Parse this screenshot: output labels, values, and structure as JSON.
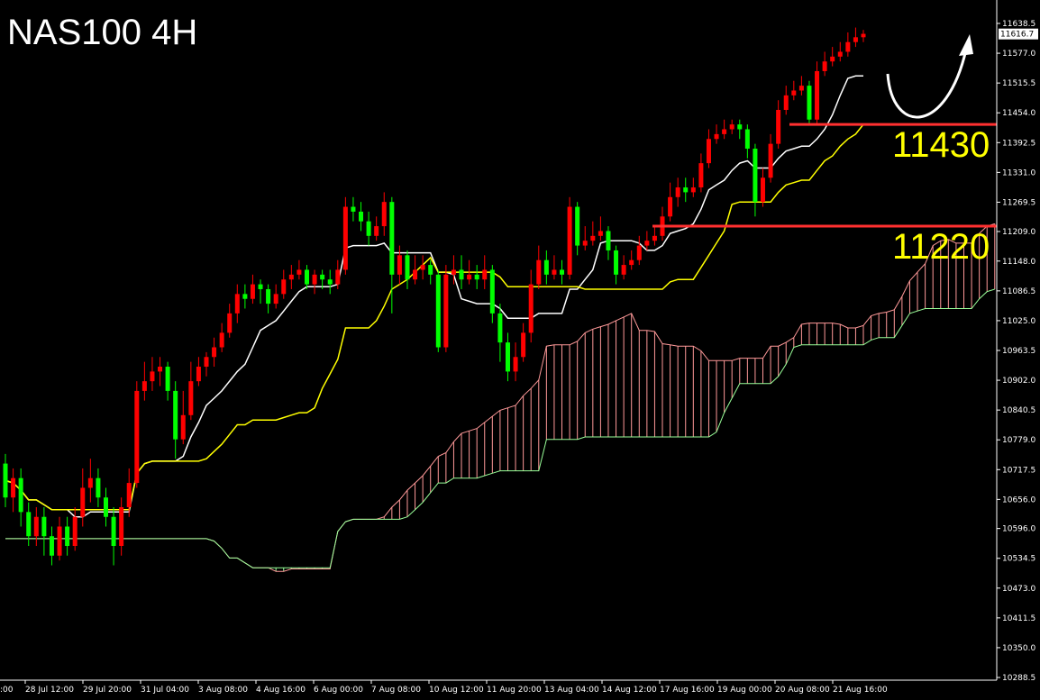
{
  "title": "NAS100 4H",
  "chart_data": {
    "type": "candlestick",
    "symbol": "NAS100",
    "timeframe": "4H",
    "ylim": [
      10288.5,
      11638.5
    ],
    "y_ticks": [
      "11638.5",
      "11577.0",
      "11515.5",
      "11454.0",
      "11392.5",
      "11331.0",
      "11269.5",
      "11209.0",
      "11148.0",
      "11086.5",
      "11025.0",
      "10963.5",
      "10902.0",
      "10840.5",
      "10779.0",
      "10717.5",
      "10656.0",
      "10596.0",
      "10534.5",
      "10473.0",
      "10411.5",
      "10350.0",
      "10288.5"
    ],
    "current_price": "11616.7",
    "x_ticks": [
      "28 Jul 12:00",
      "29 Jul 20:00",
      "31 Jul 04:00",
      "3 Aug 08:00",
      "4 Aug 16:00",
      "6 Aug 00:00",
      "7 Aug 08:00",
      "10 Aug 12:00",
      "11 Aug 20:00",
      "13 Aug 04:00",
      "14 Aug 12:00",
      "17 Aug 16:00",
      "19 Aug 00:00",
      "20 Aug 08:00",
      "21 Aug 16:00"
    ],
    "x_tick_first_partial": ":00",
    "up_color": "#ff0000",
    "down_color": "#00ff00",
    "candles": [
      [
        10730,
        10660,
        10750,
        10640
      ],
      [
        10660,
        10700,
        10720,
        10630
      ],
      [
        10700,
        10630,
        10720,
        10600
      ],
      [
        10630,
        10580,
        10650,
        10560
      ],
      [
        10580,
        10620,
        10640,
        10560
      ],
      [
        10620,
        10580,
        10640,
        10540
      ],
      [
        10580,
        10540,
        10600,
        10520
      ],
      [
        10540,
        10600,
        10620,
        10530
      ],
      [
        10600,
        10560,
        10620,
        10540
      ],
      [
        10560,
        10620,
        10640,
        10550
      ],
      [
        10620,
        10680,
        10720,
        10600
      ],
      [
        10680,
        10700,
        10740,
        10650
      ],
      [
        10700,
        10660,
        10720,
        10640
      ],
      [
        10660,
        10620,
        10680,
        10600
      ],
      [
        10620,
        10560,
        10640,
        10520
      ],
      [
        10560,
        10640,
        10660,
        10540
      ],
      [
        10640,
        10690,
        10720,
        10620
      ],
      [
        10690,
        10880,
        10900,
        10680
      ],
      [
        10880,
        10900,
        10940,
        10860
      ],
      [
        10900,
        10920,
        10950,
        10880
      ],
      [
        10920,
        10930,
        10950,
        10890
      ],
      [
        10930,
        10880,
        10940,
        10860
      ],
      [
        10880,
        10780,
        10900,
        10740
      ],
      [
        10780,
        10830,
        10880,
        10770
      ],
      [
        10830,
        10900,
        10940,
        10820
      ],
      [
        10900,
        10930,
        10950,
        10890
      ],
      [
        10930,
        10950,
        10960,
        10910
      ],
      [
        10950,
        10970,
        10990,
        10930
      ],
      [
        10970,
        11000,
        11020,
        10960
      ],
      [
        11000,
        11040,
        11060,
        10990
      ],
      [
        11040,
        11080,
        11100,
        11020
      ],
      [
        11080,
        11070,
        11100,
        11050
      ],
      [
        11070,
        11100,
        11120,
        11060
      ],
      [
        11100,
        11090,
        11110,
        11060
      ],
      [
        11090,
        11060,
        11100,
        11040
      ],
      [
        11060,
        11080,
        11100,
        11050
      ],
      [
        11080,
        11110,
        11130,
        11070
      ],
      [
        11110,
        11120,
        11140,
        11090
      ],
      [
        11120,
        11130,
        11150,
        11110
      ],
      [
        11130,
        11100,
        11140,
        11090
      ],
      [
        11100,
        11120,
        11130,
        11080
      ],
      [
        11120,
        11110,
        11130,
        11090
      ],
      [
        11110,
        11100,
        11130,
        11080
      ],
      [
        11100,
        11130,
        11150,
        11090
      ],
      [
        11130,
        11260,
        11280,
        11120
      ],
      [
        11260,
        11250,
        11280,
        11230
      ],
      [
        11250,
        11230,
        11270,
        11210
      ],
      [
        11230,
        11200,
        11250,
        11180
      ],
      [
        11200,
        11220,
        11240,
        11190
      ],
      [
        11220,
        11270,
        11290,
        11200
      ],
      [
        11270,
        11120,
        11280,
        11040
      ],
      [
        11120,
        11160,
        11180,
        11100
      ],
      [
        11160,
        11110,
        11170,
        11090
      ],
      [
        11110,
        11130,
        11160,
        11100
      ],
      [
        11130,
        11140,
        11160,
        11110
      ],
      [
        11140,
        11120,
        11150,
        11100
      ],
      [
        11120,
        10970,
        11130,
        10960
      ],
      [
        10970,
        11120,
        11140,
        10960
      ],
      [
        11120,
        11130,
        11160,
        11100
      ],
      [
        11130,
        11110,
        11160,
        11090
      ],
      [
        11110,
        11120,
        11150,
        11100
      ],
      [
        11120,
        11110,
        11140,
        11090
      ],
      [
        11110,
        11130,
        11160,
        11090
      ],
      [
        11130,
        11040,
        11140,
        11020
      ],
      [
        11040,
        10980,
        11060,
        10940
      ],
      [
        10980,
        10920,
        11000,
        10900
      ],
      [
        10920,
        10950,
        10980,
        10900
      ],
      [
        10950,
        11000,
        11020,
        10940
      ],
      [
        11000,
        11100,
        11130,
        10980
      ],
      [
        11100,
        11150,
        11180,
        11090
      ],
      [
        11150,
        11120,
        11170,
        11100
      ],
      [
        11120,
        11130,
        11160,
        11110
      ],
      [
        11130,
        11120,
        11150,
        11100
      ],
      [
        11120,
        11260,
        11280,
        11110
      ],
      [
        11260,
        11180,
        11270,
        11160
      ],
      [
        11180,
        11190,
        11220,
        11170
      ],
      [
        11190,
        11200,
        11230,
        11180
      ],
      [
        11200,
        11210,
        11240,
        11190
      ],
      [
        11210,
        11170,
        11220,
        11150
      ],
      [
        11170,
        11120,
        11180,
        11100
      ],
      [
        11120,
        11140,
        11160,
        11110
      ],
      [
        11140,
        11150,
        11170,
        11130
      ],
      [
        11150,
        11180,
        11200,
        11140
      ],
      [
        11180,
        11190,
        11210,
        11170
      ],
      [
        11190,
        11200,
        11220,
        11180
      ],
      [
        11200,
        11240,
        11260,
        11190
      ],
      [
        11240,
        11280,
        11310,
        11230
      ],
      [
        11280,
        11300,
        11320,
        11260
      ],
      [
        11300,
        11290,
        11320,
        11270
      ],
      [
        11290,
        11300,
        11320,
        11280
      ],
      [
        11300,
        11350,
        11370,
        11290
      ],
      [
        11350,
        11400,
        11420,
        11340
      ],
      [
        11400,
        11410,
        11430,
        11390
      ],
      [
        11410,
        11420,
        11440,
        11400
      ],
      [
        11420,
        11430,
        11440,
        11410
      ],
      [
        11430,
        11420,
        11440,
        11400
      ],
      [
        11420,
        11380,
        11430,
        11360
      ],
      [
        11380,
        11270,
        11390,
        11240
      ],
      [
        11270,
        11320,
        11340,
        11260
      ],
      [
        11320,
        11390,
        11410,
        11310
      ],
      [
        11390,
        11460,
        11480,
        11380
      ],
      [
        11460,
        11490,
        11510,
        11450
      ],
      [
        11490,
        11500,
        11520,
        11480
      ],
      [
        11500,
        11510,
        11530,
        11490
      ],
      [
        11510,
        11440,
        11520,
        11430
      ],
      [
        11440,
        11540,
        11560,
        11430
      ],
      [
        11540,
        11560,
        11580,
        11530
      ],
      [
        11560,
        11570,
        11590,
        11550
      ],
      [
        11570,
        11580,
        11600,
        11560
      ],
      [
        11580,
        11600,
        11620,
        11570
      ],
      [
        11600,
        11610,
        11630,
        11590
      ],
      [
        11610,
        11617,
        11625,
        11600
      ]
    ],
    "tenkan_color": "#ffffff",
    "kijun_color": "#ffff00",
    "cloud_up_color": "#ff9999",
    "cloud_down_color": "#99ff99",
    "levels": [
      {
        "value": 11430,
        "label": "11430",
        "color": "#ff3030"
      },
      {
        "value": 11220,
        "label": "11220",
        "color": "#ff3030"
      }
    ],
    "annotation": "curved-arrow-up"
  }
}
